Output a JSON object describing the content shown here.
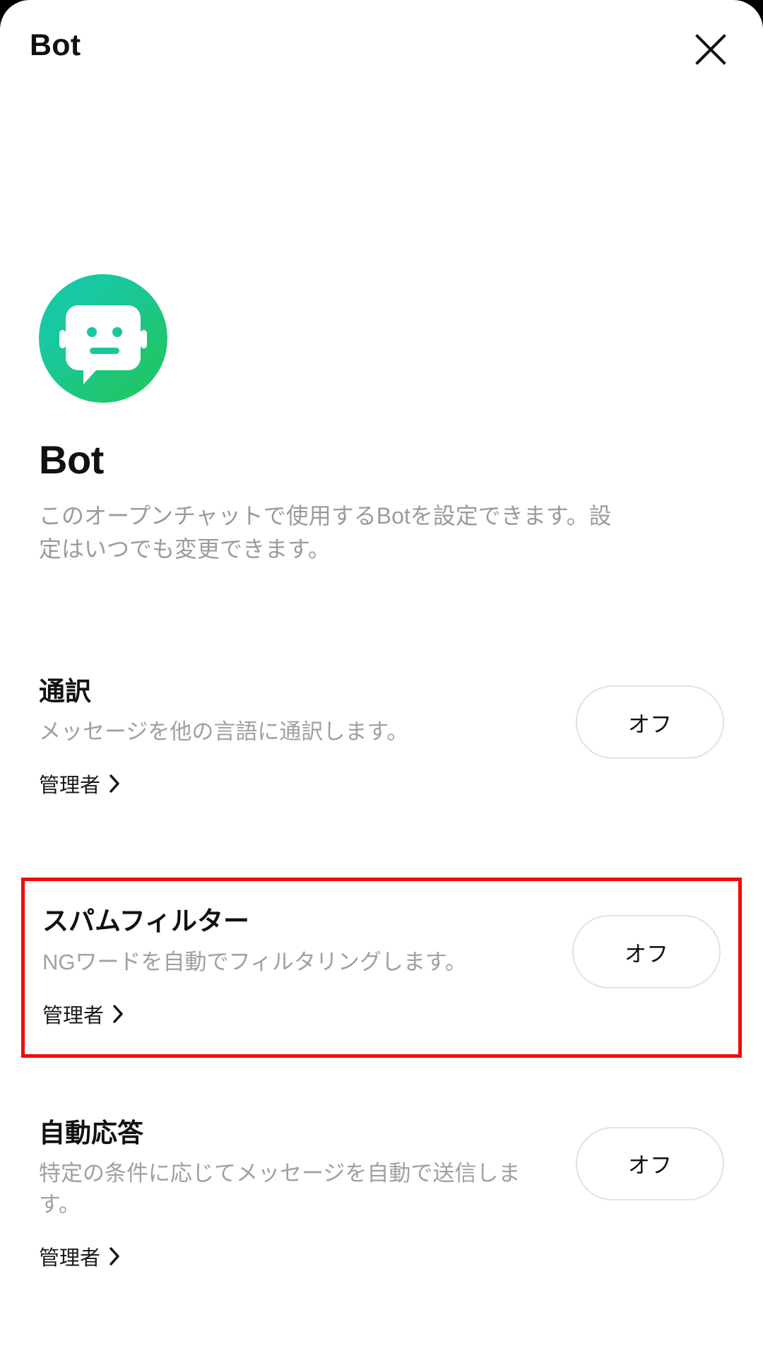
{
  "header": {
    "title": "Bot",
    "close_icon": "close-icon"
  },
  "hero": {
    "avatar_icon": "bot-avatar-icon",
    "title": "Bot",
    "description": "このオープンチャットで使用するBotを設定できます。設定はいつでも変更できます。"
  },
  "colors": {
    "avatar_gradient_start": "#13CBAD",
    "avatar_gradient_end": "#22C55E",
    "highlight_border": "#EF0C0C",
    "title_text": "#111111",
    "description_text": "#9B9B9B",
    "button_border": "#E2E2E2"
  },
  "settings": [
    {
      "title": "通訳",
      "description": "メッセージを他の言語に通訳します。",
      "admin_label": "管理者",
      "chevron_icon": "chevron-right-icon",
      "toggle_label": "オフ",
      "highlighted": false
    },
    {
      "title": "スパムフィルター",
      "description": "NGワードを自動でフィルタリングします。",
      "admin_label": "管理者",
      "chevron_icon": "chevron-right-icon",
      "toggle_label": "オフ",
      "highlighted": true
    },
    {
      "title": "自動応答",
      "description": "特定の条件に応じてメッセージを自動で送信します。",
      "admin_label": "管理者",
      "chevron_icon": "chevron-right-icon",
      "toggle_label": "オフ",
      "highlighted": false
    }
  ]
}
